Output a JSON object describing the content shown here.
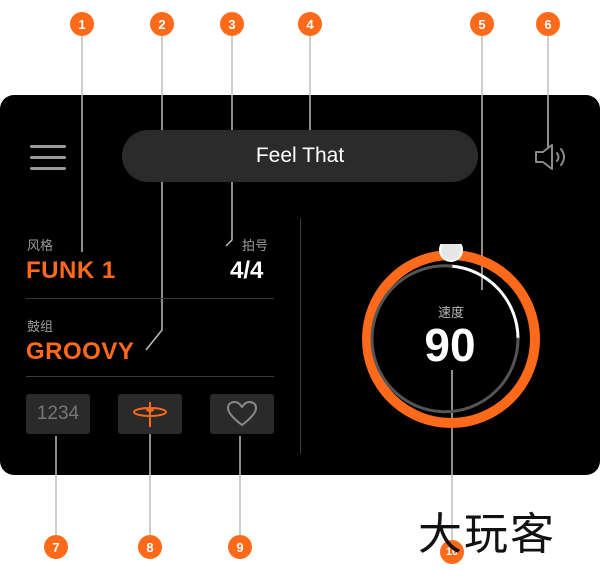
{
  "header": {
    "song_title": "Feel That"
  },
  "style": {
    "label": "风格",
    "value": "FUNK 1"
  },
  "time_signature": {
    "label": "拍号",
    "value": "4/4"
  },
  "drum_kit": {
    "label": "鼓组",
    "value": "GROOVY"
  },
  "buttons": {
    "count_in_label": "1234"
  },
  "tempo": {
    "label": "速度",
    "value": "90"
  },
  "callouts": [
    "1",
    "2",
    "3",
    "4",
    "5",
    "6",
    "7",
    "8",
    "9",
    "10"
  ],
  "watermark": "大玩客",
  "colors": {
    "accent": "#ff6a1a",
    "panel": "#000000",
    "pill": "#2b2b2b",
    "button_bg": "#2a2a2a"
  },
  "icons": {
    "menu": "hamburger-icon",
    "speaker": "speaker-icon",
    "cymbal": "cymbal-icon",
    "favorite": "heart-icon"
  }
}
